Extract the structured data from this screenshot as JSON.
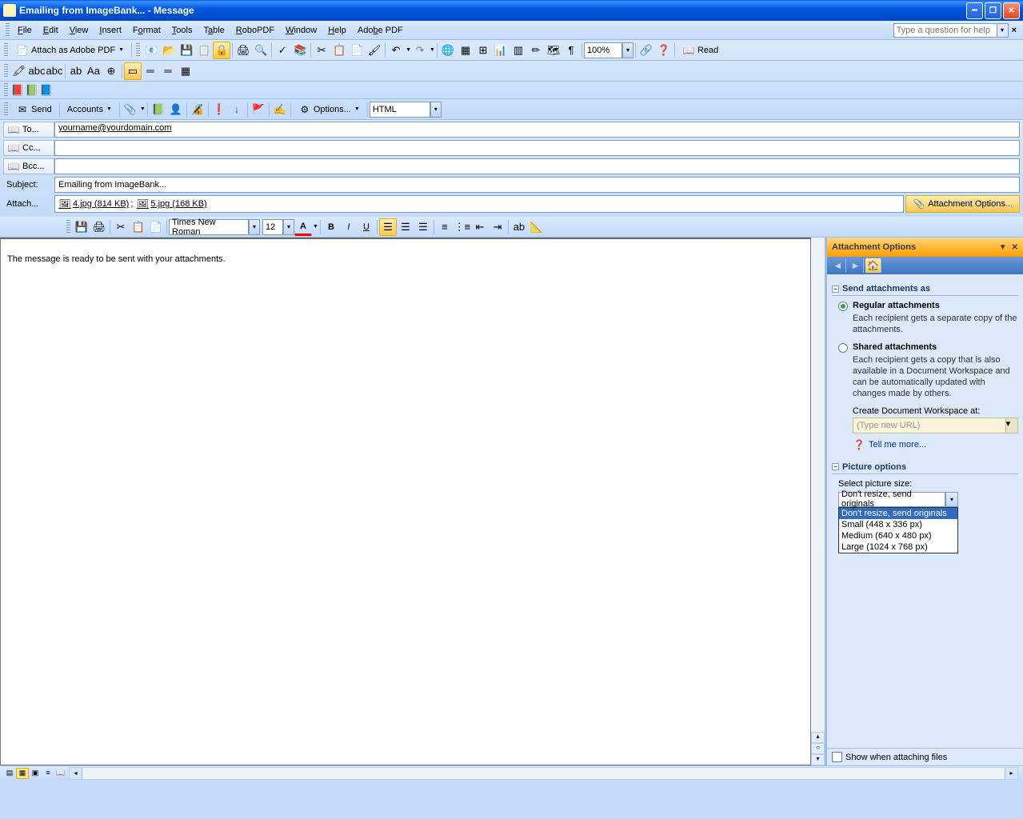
{
  "window": {
    "title": "Emailing from ImageBank... - Message"
  },
  "menus": [
    "File",
    "Edit",
    "View",
    "Insert",
    "Format",
    "Tools",
    "Table",
    "RoboPDF",
    "Window",
    "Help",
    "Adobe PDF"
  ],
  "help_placeholder": "Type a question for help",
  "attach_pdf_btn": "Attach as Adobe PDF",
  "zoom": "100%",
  "read_btn": "Read",
  "send_toolbar": {
    "send": "Send",
    "accounts": "Accounts",
    "options": "Options...",
    "format_combo": "HTML"
  },
  "mail": {
    "to_label": "To...",
    "to_value": "yourname@yourdomain.com",
    "cc_label": "Cc...",
    "cc_value": "",
    "bcc_label": "Bcc...",
    "bcc_value": "",
    "subject_label": "Subject:",
    "subject_value": "Emailing from ImageBank...",
    "attach_label": "Attach...",
    "attachments": [
      {
        "name": "4.jpg (814 KB)"
      },
      {
        "name": "5.jpg (168 KB)"
      }
    ],
    "attach_options_btn": "Attachment Options..."
  },
  "format_toolbar": {
    "font": "Times New Roman",
    "size": "12"
  },
  "body_text": "The message is ready to be sent with your attachments.",
  "taskpane": {
    "title": "Attachment Options",
    "section1": "Send attachments as",
    "opt1_label": "Regular attachments",
    "opt1_desc": "Each recipient gets a separate copy of the attachments.",
    "opt2_label": "Shared attachments",
    "opt2_desc": "Each recipient gets a copy that is also available in a Document Workspace and can be automatically updated with changes made by others.",
    "workspace_label": "Create Document Workspace at:",
    "workspace_placeholder": "(Type new URL)",
    "tellmore": "Tell me more...",
    "section2": "Picture options",
    "pic_label": "Select picture size:",
    "pic_selected": "Don't resize, send originals",
    "pic_options": [
      "Don't resize, send originals",
      "Small (448 x 336 px)",
      "Medium (640 x 480 px)",
      "Large (1024 x 768 px)"
    ],
    "show_when": "Show when attaching files"
  }
}
